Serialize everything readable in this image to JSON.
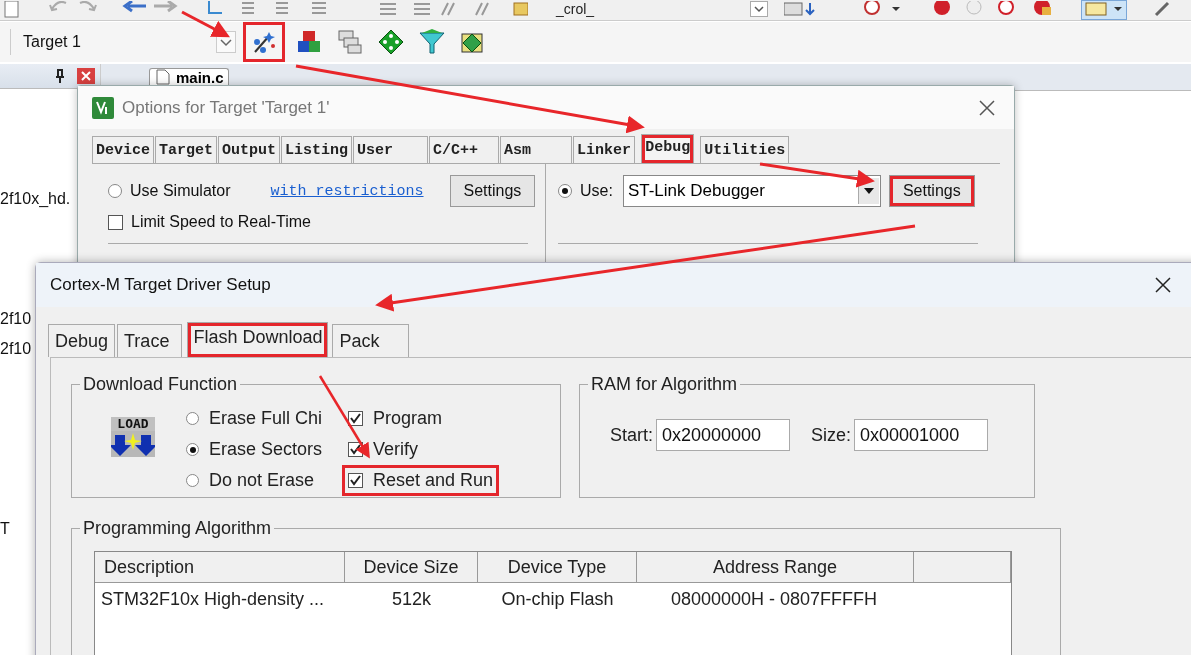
{
  "toolbar_top": {
    "combo_value": "_crol_"
  },
  "toolbar": {
    "target_combo": "Target 1",
    "options_button": {
      "highlighted": true
    }
  },
  "project_panel": {
    "lines": [
      "2f10x_hd.",
      "2f10",
      "2f10",
      "T"
    ]
  },
  "editor_tab": "main.c",
  "options_window": {
    "title": "Options for Target 'Target 1'",
    "tabs": [
      {
        "label": "Device",
        "selected": false,
        "highlighted": false
      },
      {
        "label": "Target",
        "selected": false,
        "highlighted": false
      },
      {
        "label": "Output",
        "selected": false,
        "highlighted": false
      },
      {
        "label": "Listing",
        "selected": false,
        "highlighted": false
      },
      {
        "label": "User",
        "selected": false,
        "highlighted": false
      },
      {
        "label": "C/C++",
        "selected": false,
        "highlighted": false
      },
      {
        "label": "Asm",
        "selected": false,
        "highlighted": false
      },
      {
        "label": "Linker",
        "selected": false,
        "highlighted": false
      },
      {
        "label": "Debug",
        "selected": true,
        "highlighted": true
      },
      {
        "label": "Utilities",
        "selected": false,
        "highlighted": false
      }
    ],
    "simulator": {
      "label": "Use Simulator",
      "selected": false
    },
    "restrictions_link": "with restrictions",
    "simulator_settings": {
      "label": "Settings",
      "highlighted": false
    },
    "limit_speed": {
      "label": "Limit Speed to Real-Time",
      "checked": false
    },
    "use": {
      "label": "Use:",
      "selected": true
    },
    "debugger": "ST-Link Debugger",
    "debugger_settings": {
      "label": "Settings",
      "highlighted": true
    }
  },
  "driver_dialog": {
    "title": "Cortex-M Target Driver Setup",
    "tabs": [
      {
        "label": "Debug",
        "selected": false,
        "highlighted": false
      },
      {
        "label": "Trace",
        "selected": false,
        "highlighted": false
      },
      {
        "label": "Flash Download",
        "selected": true,
        "highlighted": true
      },
      {
        "label": "Pack",
        "selected": false,
        "highlighted": false
      }
    ],
    "download_function": {
      "title": "Download Function",
      "icon_text": "LOAD",
      "erase_options": [
        {
          "label": "Erase Full Chi",
          "selected": false
        },
        {
          "label": "Erase Sectors",
          "selected": true
        },
        {
          "label": "Do not Erase",
          "selected": false
        }
      ],
      "actions": [
        {
          "label": "Program",
          "checked": true,
          "highlighted": false
        },
        {
          "label": "Verify",
          "checked": true,
          "highlighted": false
        },
        {
          "label": "Reset and Run",
          "checked": true,
          "highlighted": true
        }
      ]
    },
    "ram": {
      "title": "RAM for Algorithm",
      "start_label": "Start:",
      "start": "0x20000000",
      "size_label": "Size:",
      "size": "0x00001000"
    },
    "programming_algorithm": {
      "title": "Programming Algorithm",
      "columns": [
        "Description",
        "Device Size",
        "Device Type",
        "Address Range"
      ],
      "rows": [
        [
          "STM32F10x High-density ...",
          "512k",
          "On-chip Flash",
          "08000000H - 0807FFFFH"
        ]
      ]
    }
  }
}
